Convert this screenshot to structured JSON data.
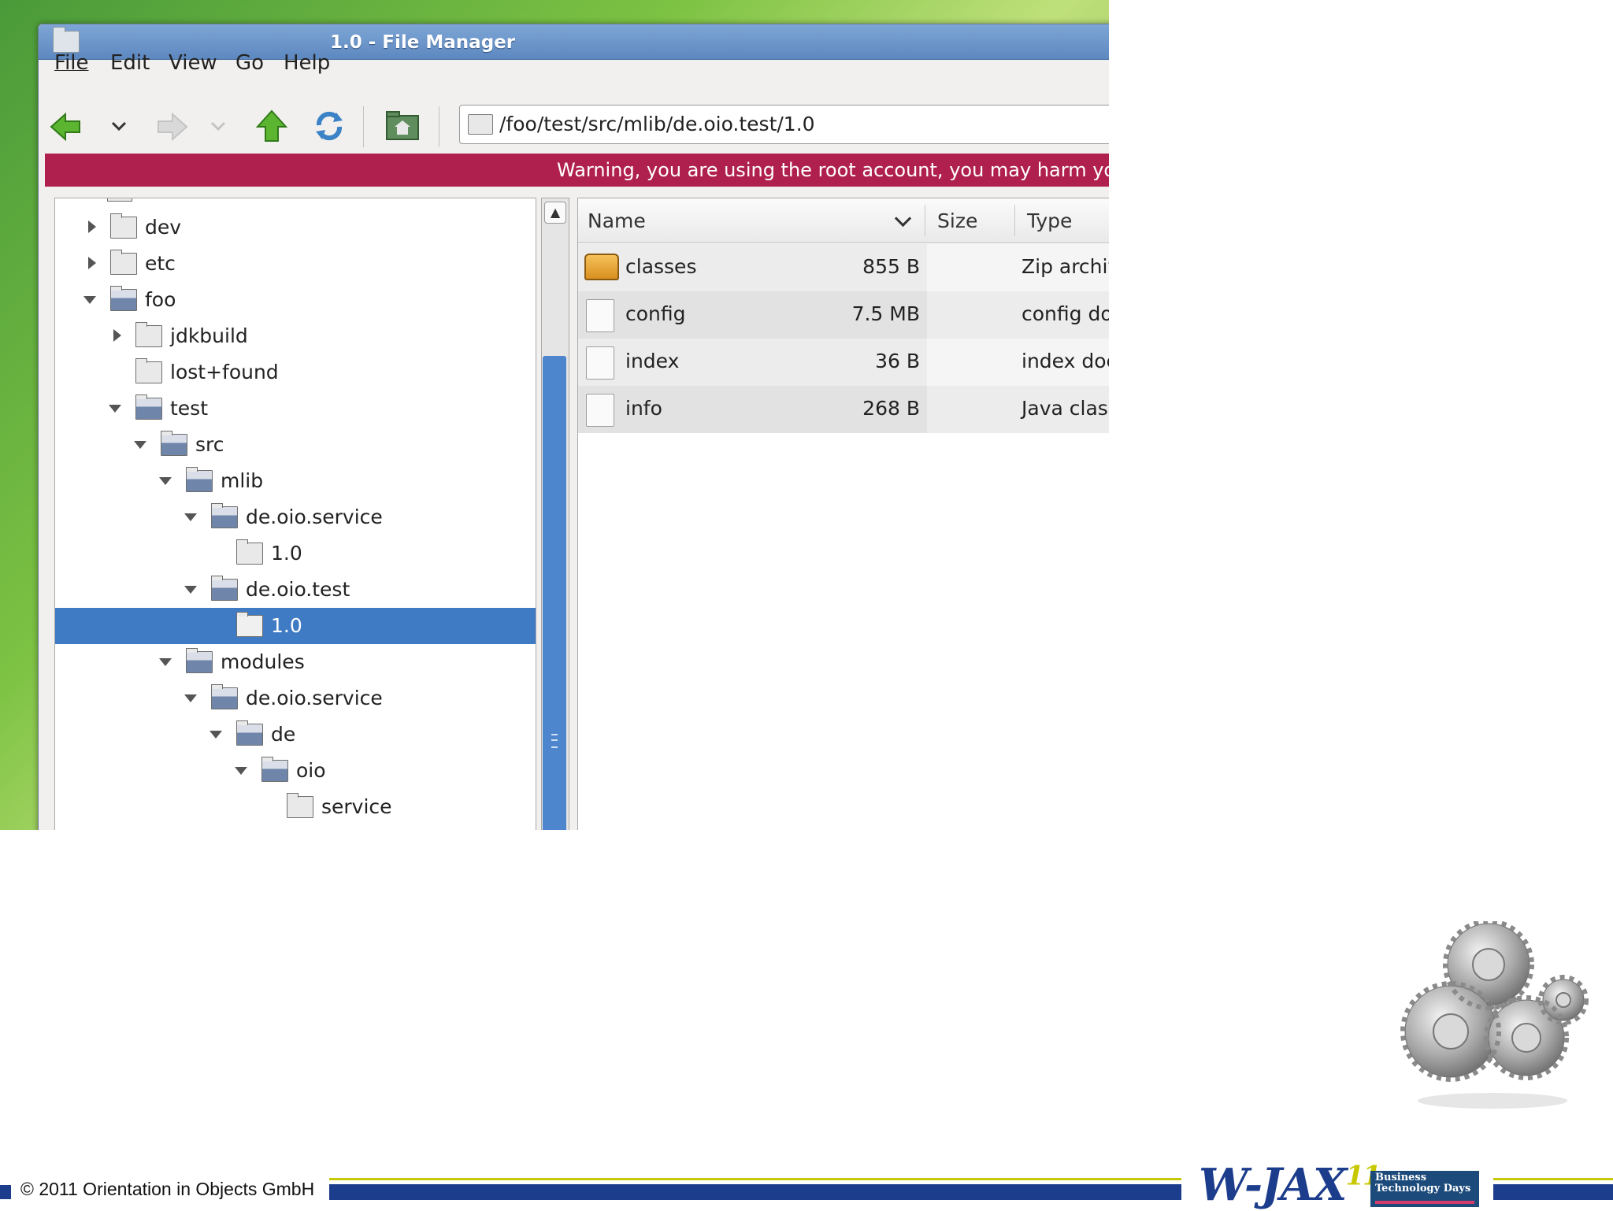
{
  "window": {
    "title": "1.0 - File Manager",
    "menu": [
      "File",
      "Edit",
      "View",
      "Go",
      "Help"
    ],
    "address": "/foo/test/src/mlib/de.oio.test/1.0",
    "warning": "Warning, you are using the root account, you may harm you"
  },
  "tree": {
    "items": [
      {
        "label": "dev",
        "level": 1,
        "state": "collapsed"
      },
      {
        "label": "etc",
        "level": 1,
        "state": "collapsed"
      },
      {
        "label": "foo",
        "level": 1,
        "state": "expanded"
      },
      {
        "label": "jdkbuild",
        "level": 2,
        "state": "collapsed"
      },
      {
        "label": "lost+found",
        "level": 2,
        "state": "leaf"
      },
      {
        "label": "test",
        "level": 2,
        "state": "expanded"
      },
      {
        "label": "src",
        "level": 3,
        "state": "expanded"
      },
      {
        "label": "mlib",
        "level": 4,
        "state": "expanded"
      },
      {
        "label": "de.oio.service",
        "level": 5,
        "state": "expanded"
      },
      {
        "label": "1.0",
        "level": 6,
        "state": "leaf"
      },
      {
        "label": "de.oio.test",
        "level": 5,
        "state": "expanded"
      },
      {
        "label": "1.0",
        "level": 6,
        "state": "leaf",
        "selected": true
      },
      {
        "label": "modules",
        "level": 4,
        "state": "expanded"
      },
      {
        "label": "de.oio.service",
        "level": 5,
        "state": "expanded"
      },
      {
        "label": "de",
        "level": 6,
        "state": "expanded"
      },
      {
        "label": "oio",
        "level": 7,
        "state": "expanded"
      },
      {
        "label": "service",
        "level": 8,
        "state": "leaf"
      }
    ]
  },
  "list": {
    "columns": {
      "name": "Name",
      "size": "Size",
      "type": "Type"
    },
    "rows": [
      {
        "name": "classes",
        "size": "855 B",
        "type": "Zip archiv",
        "icon": "zip-archive-icon"
      },
      {
        "name": "config",
        "size": "7.5 MB",
        "type": "config doc",
        "icon": "document-icon"
      },
      {
        "name": "index",
        "size": "36 B",
        "type": "index doc",
        "icon": "document-icon"
      },
      {
        "name": "info",
        "size": "268 B",
        "type": "Java class",
        "icon": "document-icon"
      }
    ]
  },
  "footer": {
    "copyright": "© 2011 Orientation in Objects GmbH",
    "wjax": "W-JAX",
    "wjax_year": "11",
    "btd": "Business Technology Days"
  }
}
